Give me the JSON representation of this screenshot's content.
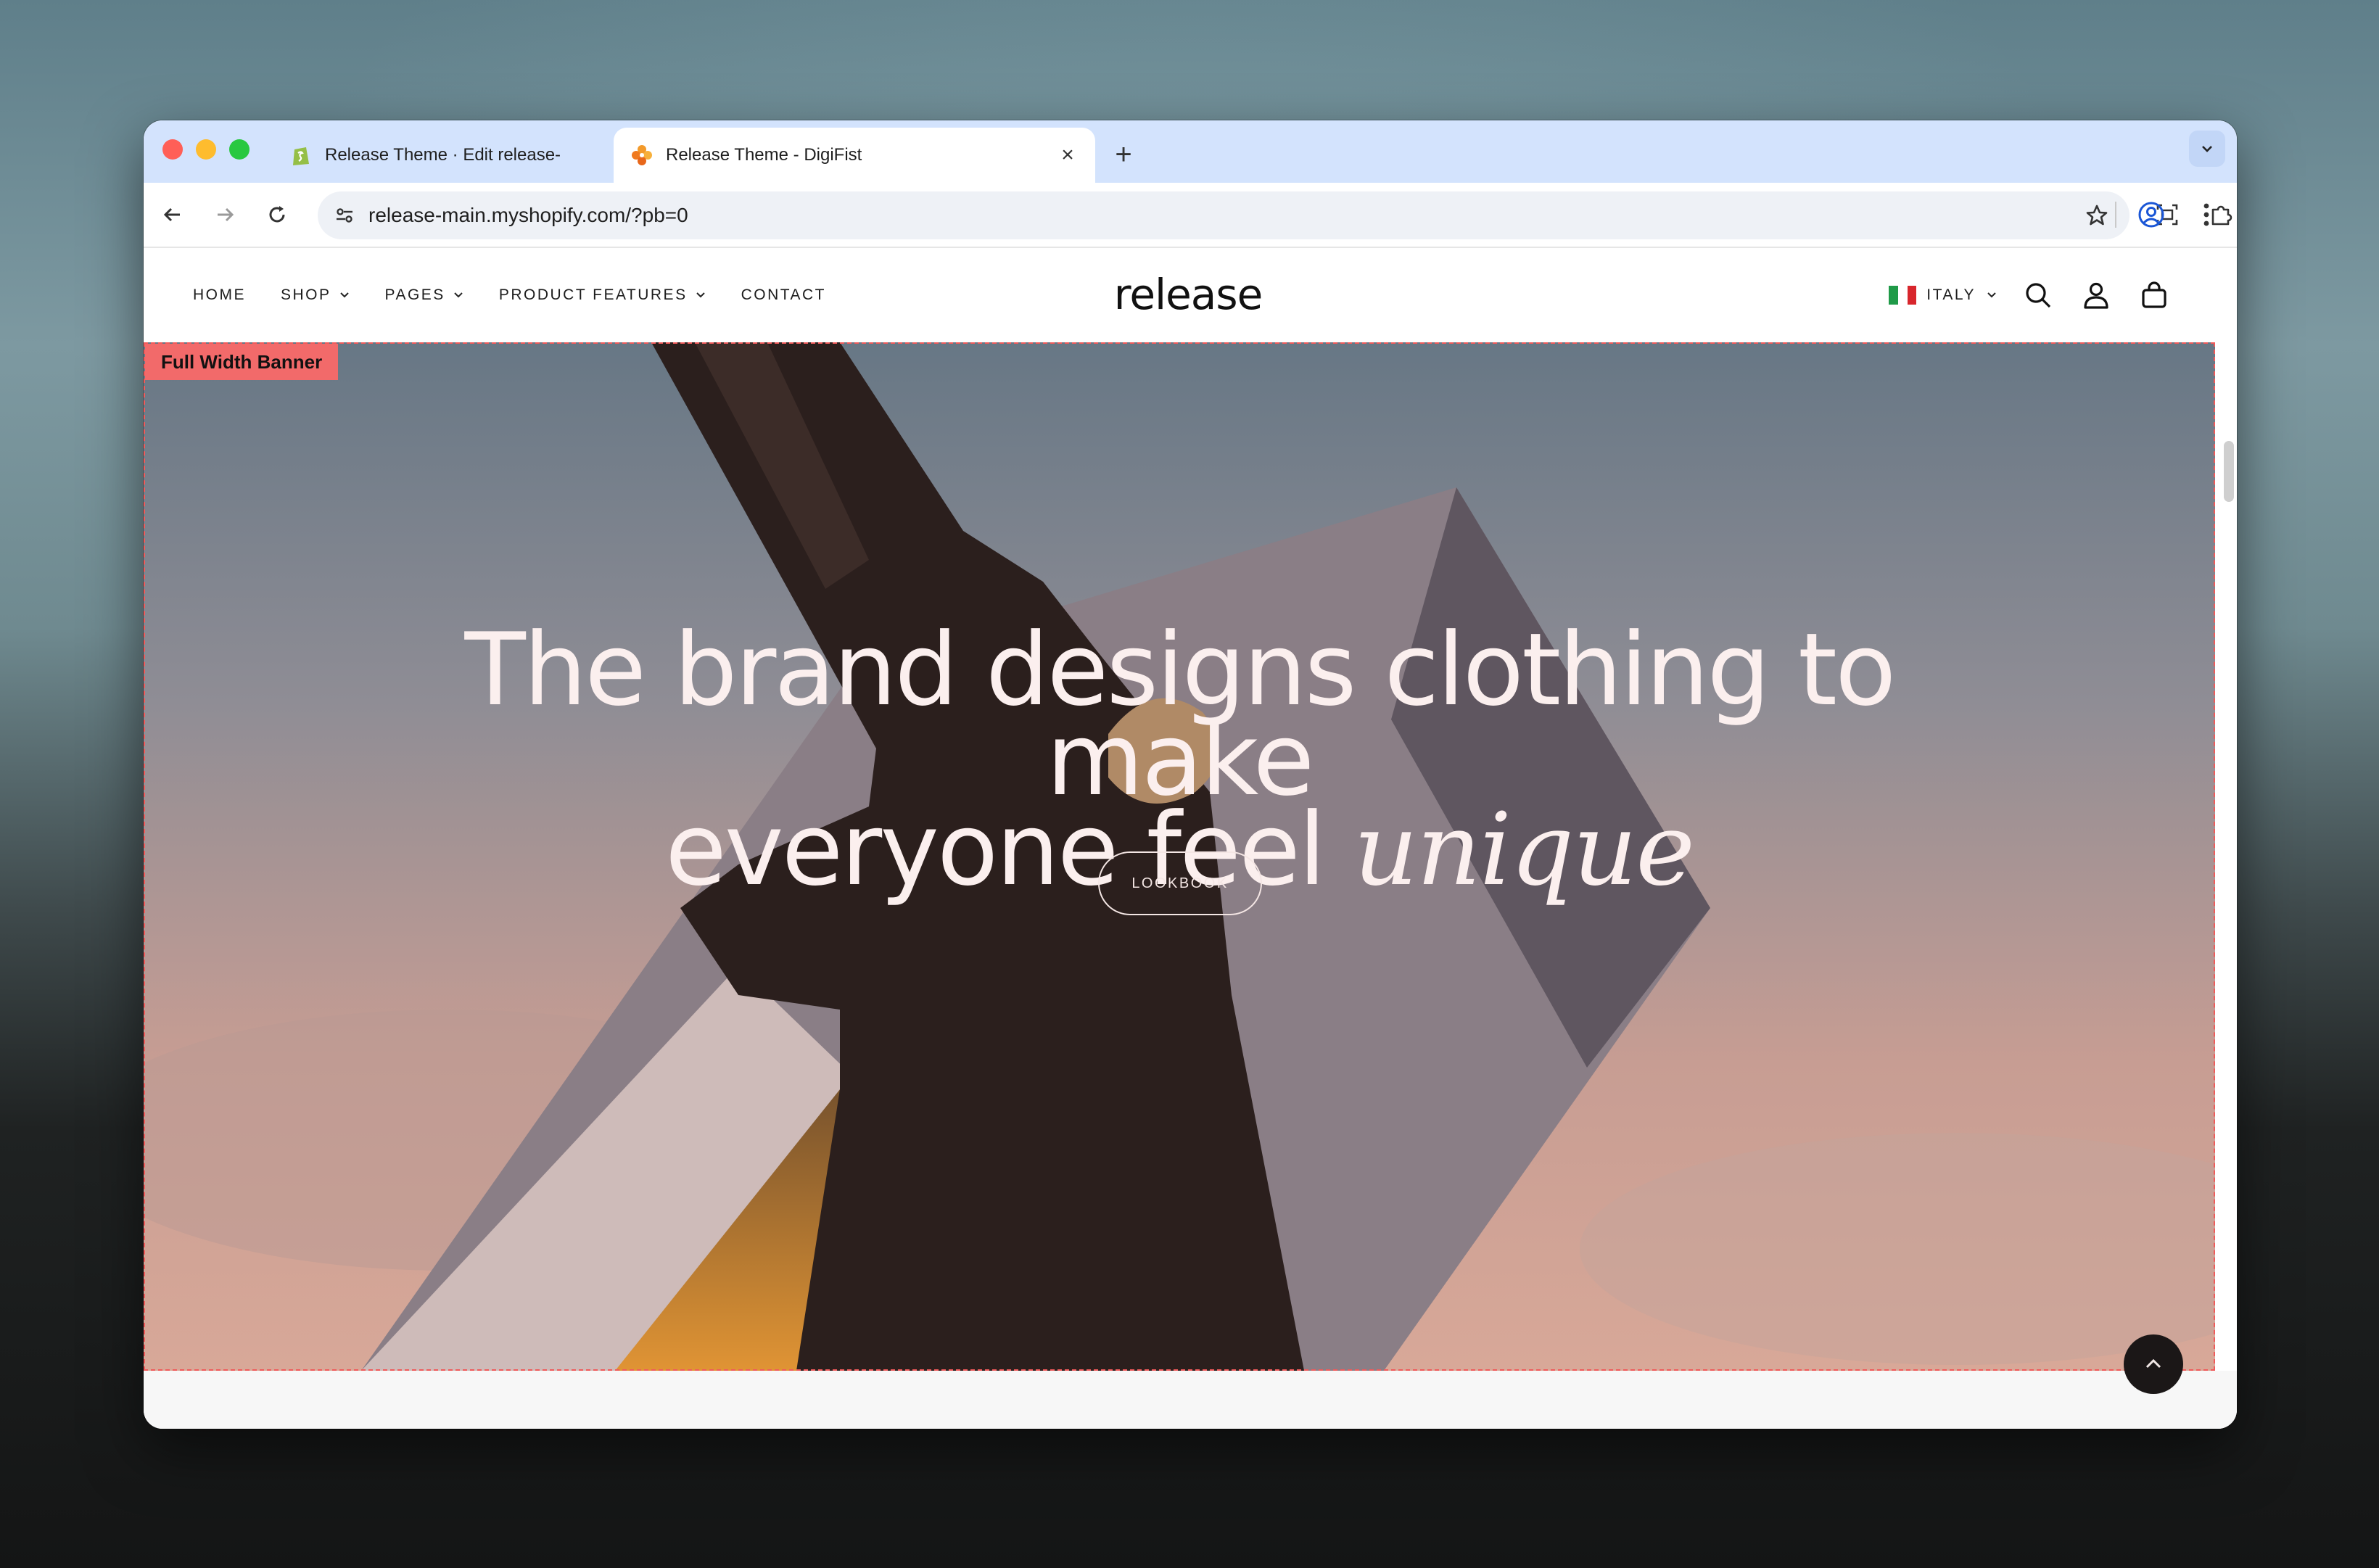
{
  "browser": {
    "tabs": [
      {
        "title": "Release Theme · Edit release-",
        "active": false
      },
      {
        "title": "Release Theme - DigiFist",
        "active": true
      }
    ],
    "url": "release-main.myshopify.com/?pb=0"
  },
  "site": {
    "logo": "release",
    "nav": [
      {
        "label": "HOME",
        "has_dropdown": false
      },
      {
        "label": "SHOP",
        "has_dropdown": true
      },
      {
        "label": "PAGES",
        "has_dropdown": true
      },
      {
        "label": "PRODUCT FEATURES",
        "has_dropdown": true
      },
      {
        "label": "CONTACT",
        "has_dropdown": false
      }
    ],
    "country": "ITALY"
  },
  "banner": {
    "section_label": "Full Width Banner",
    "headline_line1": "The brand designs clothing to make",
    "headline_line2": "everyone feel",
    "headline_italic": "unique",
    "cta_label": "LOOKBOOK"
  },
  "colors": {
    "tab_strip": "#d3e3fd",
    "banner_outline": "#f05a5a",
    "headline": "#fbefee",
    "back_to_top": "#1b1717"
  }
}
